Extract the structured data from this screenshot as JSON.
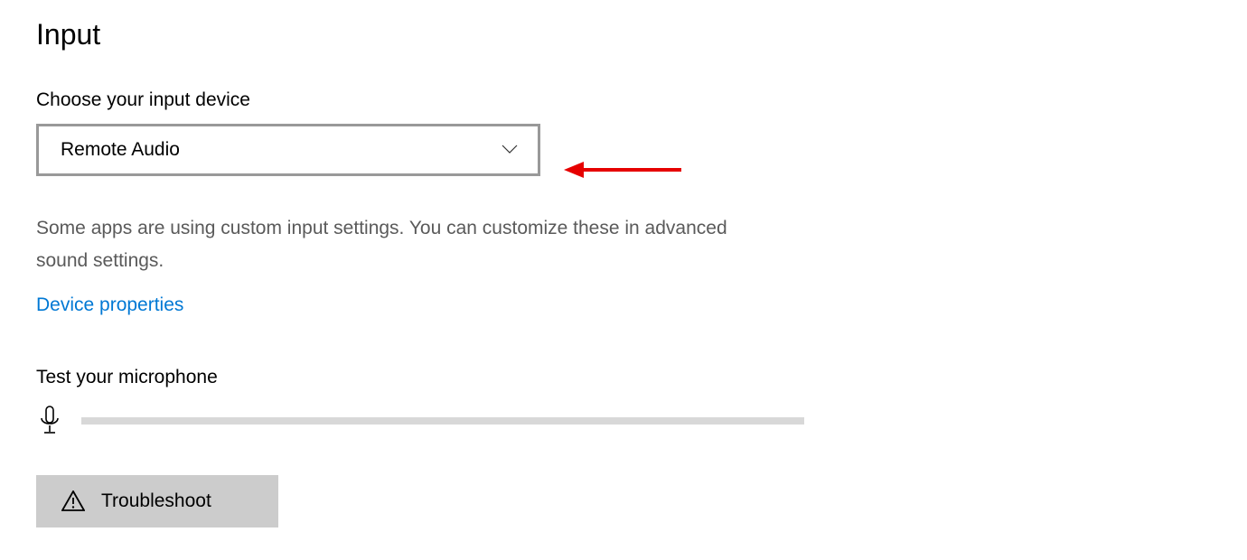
{
  "section": {
    "title": "Input"
  },
  "input_device": {
    "label": "Choose your input device",
    "selected": "Remote Audio"
  },
  "description": "Some apps are using custom input settings. You can customize these in advanced sound settings.",
  "link": {
    "device_properties": "Device properties"
  },
  "microphone": {
    "label": "Test your microphone"
  },
  "troubleshoot": {
    "label": "Troubleshoot"
  }
}
